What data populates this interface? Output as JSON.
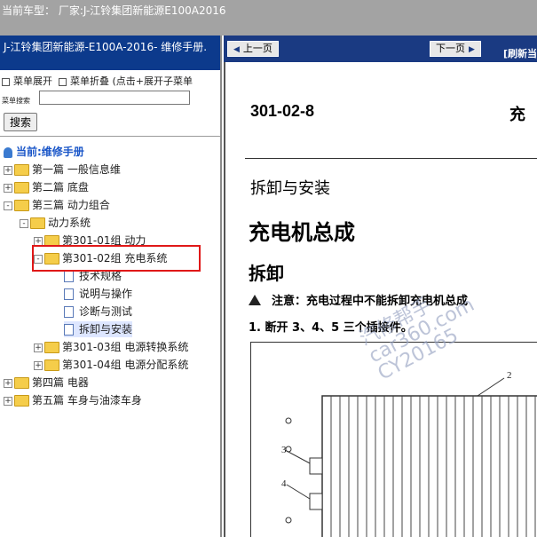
{
  "window": {
    "title": "当前车型： 厂家:J-江铃集团新能源E100A2016"
  },
  "left": {
    "header": "J-江铃集团新能源-E100A-2016- 维修手册.",
    "menu_expand": "菜单展开",
    "menu_collapse": "菜单折叠 (点击+展开子菜单",
    "search_label": "菜单搜索",
    "search_value": "",
    "search_button": "搜索",
    "tree_root": "当前:维修手册",
    "tree": [
      {
        "label": "第一篇 一般信息维",
        "exp": "+"
      },
      {
        "label": "第二篇 底盘",
        "exp": "+"
      },
      {
        "label": "第三篇 动力组合",
        "exp": "-"
      },
      {
        "label": "动力系统",
        "exp": "-"
      },
      {
        "label": "第301-01组 动力",
        "exp": "+"
      },
      {
        "label": "第301-02组 充电系统",
        "exp": "-"
      },
      {
        "label": "技术规格"
      },
      {
        "label": "说明与操作"
      },
      {
        "label": "诊断与测试"
      },
      {
        "label": "拆卸与安装"
      },
      {
        "label": "第301-03组 电源转换系统",
        "exp": "+"
      },
      {
        "label": "第301-04组 电源分配系统",
        "exp": "+"
      },
      {
        "label": "第四篇 电器",
        "exp": "+"
      },
      {
        "label": "第五篇 车身与油漆车身",
        "exp": "+"
      }
    ]
  },
  "nav": {
    "prev": "上一页",
    "next": "下一页",
    "refresh": "[刷新当"
  },
  "doc": {
    "code": "301-02-8",
    "head_cut": "充",
    "section": "拆卸与安装",
    "part": "充电机总成",
    "subsection": "拆卸",
    "warning": "注意：充电过程中不能拆卸充电机总成",
    "step": "1.   断开 3、4、5 三个插接件。",
    "figure_labels": {
      "l2": "2",
      "l3": "3",
      "l4": "4"
    }
  },
  "watermark": {
    "line1": "汽修帮手",
    "line2": "car360.com",
    "line3": "CY20165"
  },
  "colors": {
    "header_blue": "#0c3a8c",
    "nav_blue": "#1a3a82",
    "highlight_red": "#e01818",
    "folder_yellow": "#f5cd4a"
  }
}
